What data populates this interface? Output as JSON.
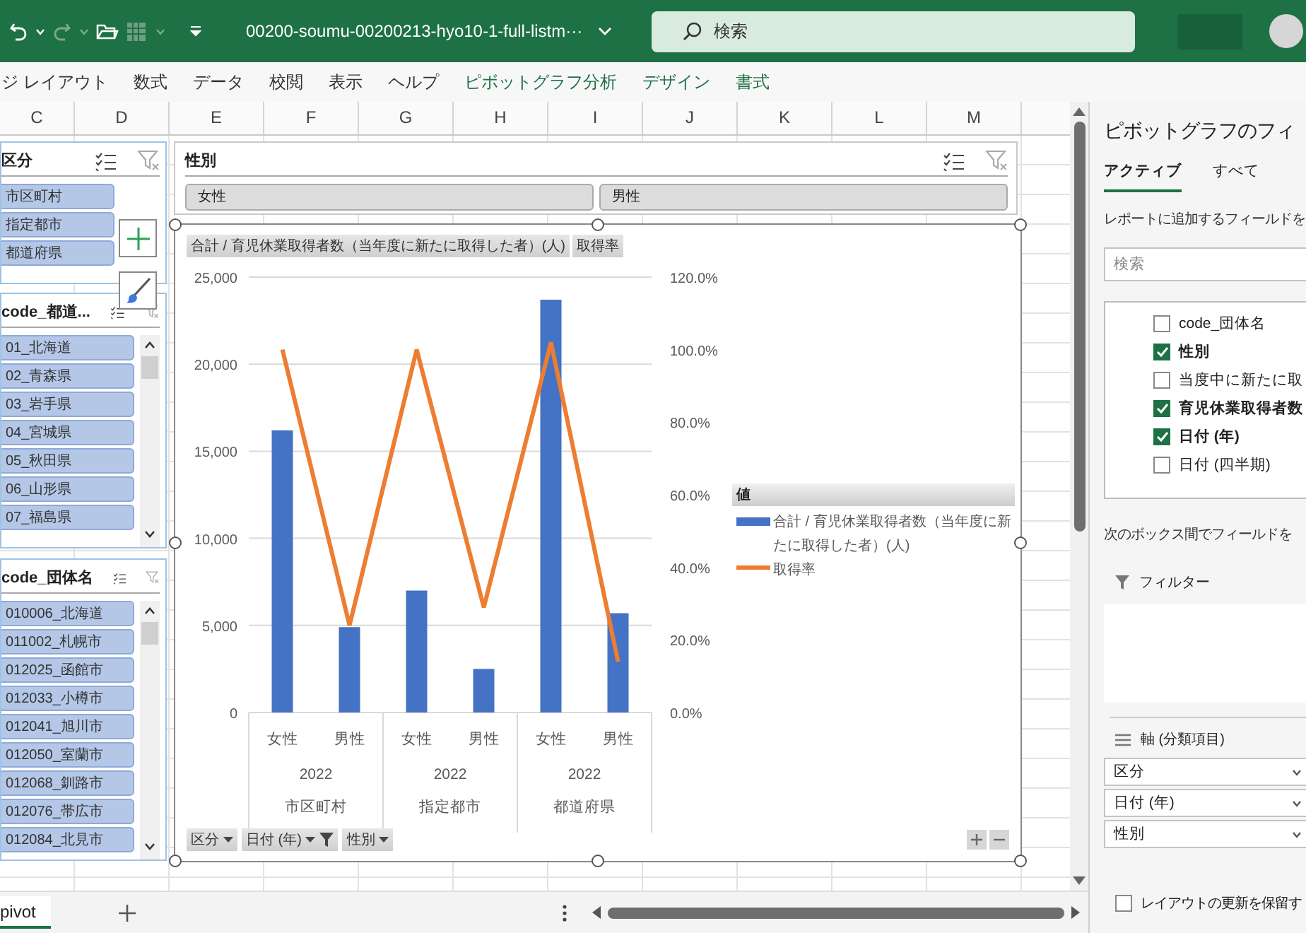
{
  "title_bar": {
    "filename": "00200-soumu-00200213-hyo10-1-full-listm···",
    "search_placeholder": "検索"
  },
  "ribbon_tabs": [
    {
      "label": "ジ レイアウト",
      "kind": "normal"
    },
    {
      "label": "数式",
      "kind": "normal"
    },
    {
      "label": "データ",
      "kind": "normal"
    },
    {
      "label": "校閲",
      "kind": "normal"
    },
    {
      "label": "表示",
      "kind": "normal"
    },
    {
      "label": "ヘルプ",
      "kind": "normal"
    },
    {
      "label": "ピボットグラフ分析",
      "kind": "contextual"
    },
    {
      "label": "デザイン",
      "kind": "contextual"
    },
    {
      "label": "書式",
      "kind": "contextual"
    }
  ],
  "columns": [
    "C",
    "D",
    "E",
    "F",
    "G",
    "H",
    "I",
    "J",
    "K",
    "L",
    "M"
  ],
  "slicers": [
    {
      "title": "区分",
      "scrollable": false,
      "items": [
        "市区町村",
        "指定都市",
        "都道府県"
      ]
    },
    {
      "title": "code_都道...",
      "scrollable": true,
      "items": [
        "01_北海道",
        "02_青森県",
        "03_岩手県",
        "04_宮城県",
        "05_秋田県",
        "06_山形県",
        "07_福島県"
      ]
    },
    {
      "title": "code_団体名",
      "scrollable": true,
      "items": [
        "010006_北海道",
        "011002_札幌市",
        "012025_函館市",
        "012033_小樽市",
        "012041_旭川市",
        "012050_室蘭市",
        "012068_釧路市",
        "012076_帯広市",
        "012084_北見市"
      ]
    }
  ],
  "gender_slicer": {
    "title": "性別",
    "items": [
      "女性",
      "男性"
    ]
  },
  "chart": {
    "value_buttons": [
      "合計 / 育児休業取得者数（当年度に新たに取得した者）(人)",
      "取得率"
    ],
    "chart_data": {
      "type": "bar",
      "categories": [
        "女性",
        "男性",
        "女性",
        "男性",
        "女性",
        "男性"
      ],
      "series": [
        {
          "name": "合計 / 育児休業取得者数（当年度に新たに取得した者）(人)",
          "type": "bar",
          "color": "#4472c4",
          "values": [
            16200,
            4900,
            7000,
            2500,
            23700,
            5700
          ]
        },
        {
          "name": "取得率",
          "type": "line",
          "axis": "y2",
          "color": "#ed7d31",
          "values": [
            1.0,
            0.24,
            1.0,
            0.29,
            1.02,
            0.14
          ]
        }
      ],
      "grid": true,
      "ylim": [
        0,
        25000
      ],
      "yticks": [
        {
          "value": 0,
          "label": "0"
        },
        {
          "value": 5000,
          "label": "5,000"
        },
        {
          "value": 10000,
          "label": "10,000"
        },
        {
          "value": 15000,
          "label": "15,000"
        },
        {
          "value": 20000,
          "label": "20,000"
        },
        {
          "value": 25000,
          "label": "25,000"
        }
      ],
      "y2lim": [
        0,
        1.2
      ],
      "y2ticks": [
        {
          "value": 0,
          "label": "0.0%"
        },
        {
          "value": 0.2,
          "label": "20.0%"
        },
        {
          "value": 0.4,
          "label": "40.0%"
        },
        {
          "value": 0.6,
          "label": "60.0%"
        },
        {
          "value": 0.8,
          "label": "80.0%"
        },
        {
          "value": 1.0,
          "label": "100.0%"
        },
        {
          "value": 1.2,
          "label": "120.0%"
        }
      ]
    },
    "axis_groups": [
      {
        "year": "2022",
        "group": "市区町村"
      },
      {
        "year": "2022",
        "group": "指定都市"
      },
      {
        "year": "2022",
        "group": "都道府県"
      }
    ],
    "legend_title": "値",
    "field_buttons": [
      {
        "label": "区分",
        "filtered": false
      },
      {
        "label": "日付 (年)",
        "filtered": true
      },
      {
        "label": "性別",
        "filtered": false
      }
    ]
  },
  "field_pane": {
    "title": "ピボットグラフのフィ",
    "tabs": [
      {
        "label": "アクティブ",
        "selected": true
      },
      {
        "label": "すべて",
        "selected": false
      }
    ],
    "hint": "レポートに追加するフィールドを",
    "search_placeholder": "検索",
    "fields": [
      {
        "label": "code_団体名",
        "checked": false
      },
      {
        "label": "性別",
        "checked": true
      },
      {
        "label": "当度中に新たに取",
        "checked": false
      },
      {
        "label": "育児休業取得者数",
        "checked": true
      },
      {
        "label": "日付 (年)",
        "checked": true
      },
      {
        "label": "日付 (四半期)",
        "checked": false
      }
    ],
    "drag_hint": "次のボックス間でフィールドを",
    "filter_label": "フィルター",
    "axis_label": "軸 (分類項目)",
    "axis_items": [
      "区分",
      "日付 (年)",
      "性別"
    ],
    "defer_label": "レイアウトの更新を保留す",
    "defer_checked": false
  },
  "sheet_tab": {
    "label": "pivot"
  }
}
